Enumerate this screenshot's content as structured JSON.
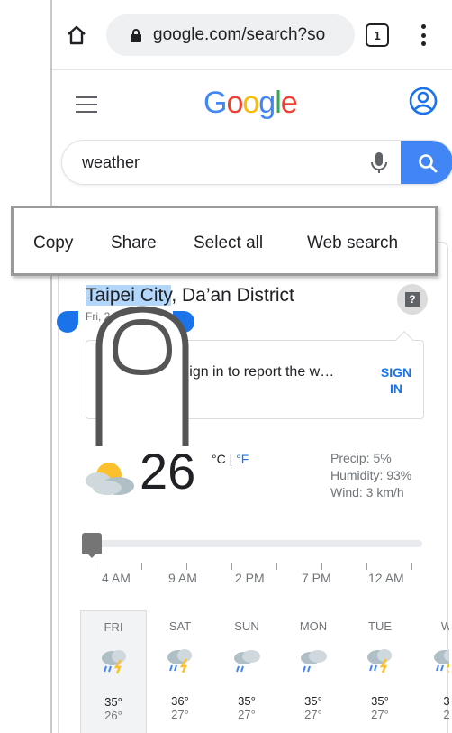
{
  "browser": {
    "url": "google.com/search?so",
    "tab_count": "1"
  },
  "header": {
    "logo_letters": [
      {
        "ch": "G",
        "color": "#4285f4"
      },
      {
        "ch": "o",
        "color": "#ea4335"
      },
      {
        "ch": "o",
        "color": "#fbbc05"
      },
      {
        "ch": "g",
        "color": "#4285f4"
      },
      {
        "ch": "l",
        "color": "#34a853"
      },
      {
        "ch": "e",
        "color": "#ea4335"
      }
    ]
  },
  "search": {
    "query": "weather"
  },
  "context_menu": {
    "copy": "Copy",
    "share": "Share",
    "select_all": "Select all",
    "web_search": "Web search"
  },
  "weather": {
    "location_selected": "Taipei City",
    "location_rest": ", Da’an District",
    "subtitle": "Fri, 2…  …st…   …oudy",
    "signin_text": "I… …now? Sign in to report the w…",
    "signin_link": "SIGN IN",
    "temperature": "26",
    "unit_c": "°C",
    "unit_sep": " | ",
    "unit_f": "°F",
    "precip": "Precip: 5%",
    "humidity": "Humidity: 93%",
    "wind": "Wind: 3 km/h",
    "hour_labels": [
      "4 AM",
      "9 AM",
      "2 PM",
      "7 PM",
      "12 AM"
    ],
    "days": [
      {
        "name": "FRI",
        "hi": "35°",
        "lo": "26°",
        "icon": "thunderstorm-icon",
        "selected": true
      },
      {
        "name": "SAT",
        "hi": "36°",
        "lo": "27°",
        "icon": "thunderstorm-icon",
        "selected": false
      },
      {
        "name": "SUN",
        "hi": "35°",
        "lo": "27°",
        "icon": "rain-icon",
        "selected": false
      },
      {
        "name": "MON",
        "hi": "35°",
        "lo": "27°",
        "icon": "rain-icon",
        "selected": false
      },
      {
        "name": "TUE",
        "hi": "35°",
        "lo": "27°",
        "icon": "thunderstorm-icon",
        "selected": false
      },
      {
        "name": "W",
        "hi": "3",
        "lo": "2",
        "icon": "thunderstorm-icon",
        "selected": false
      }
    ]
  },
  "colors": {
    "accent_blue": "#1a73e8",
    "google_blue": "#4285f4",
    "selection": "#b3d7fb"
  }
}
